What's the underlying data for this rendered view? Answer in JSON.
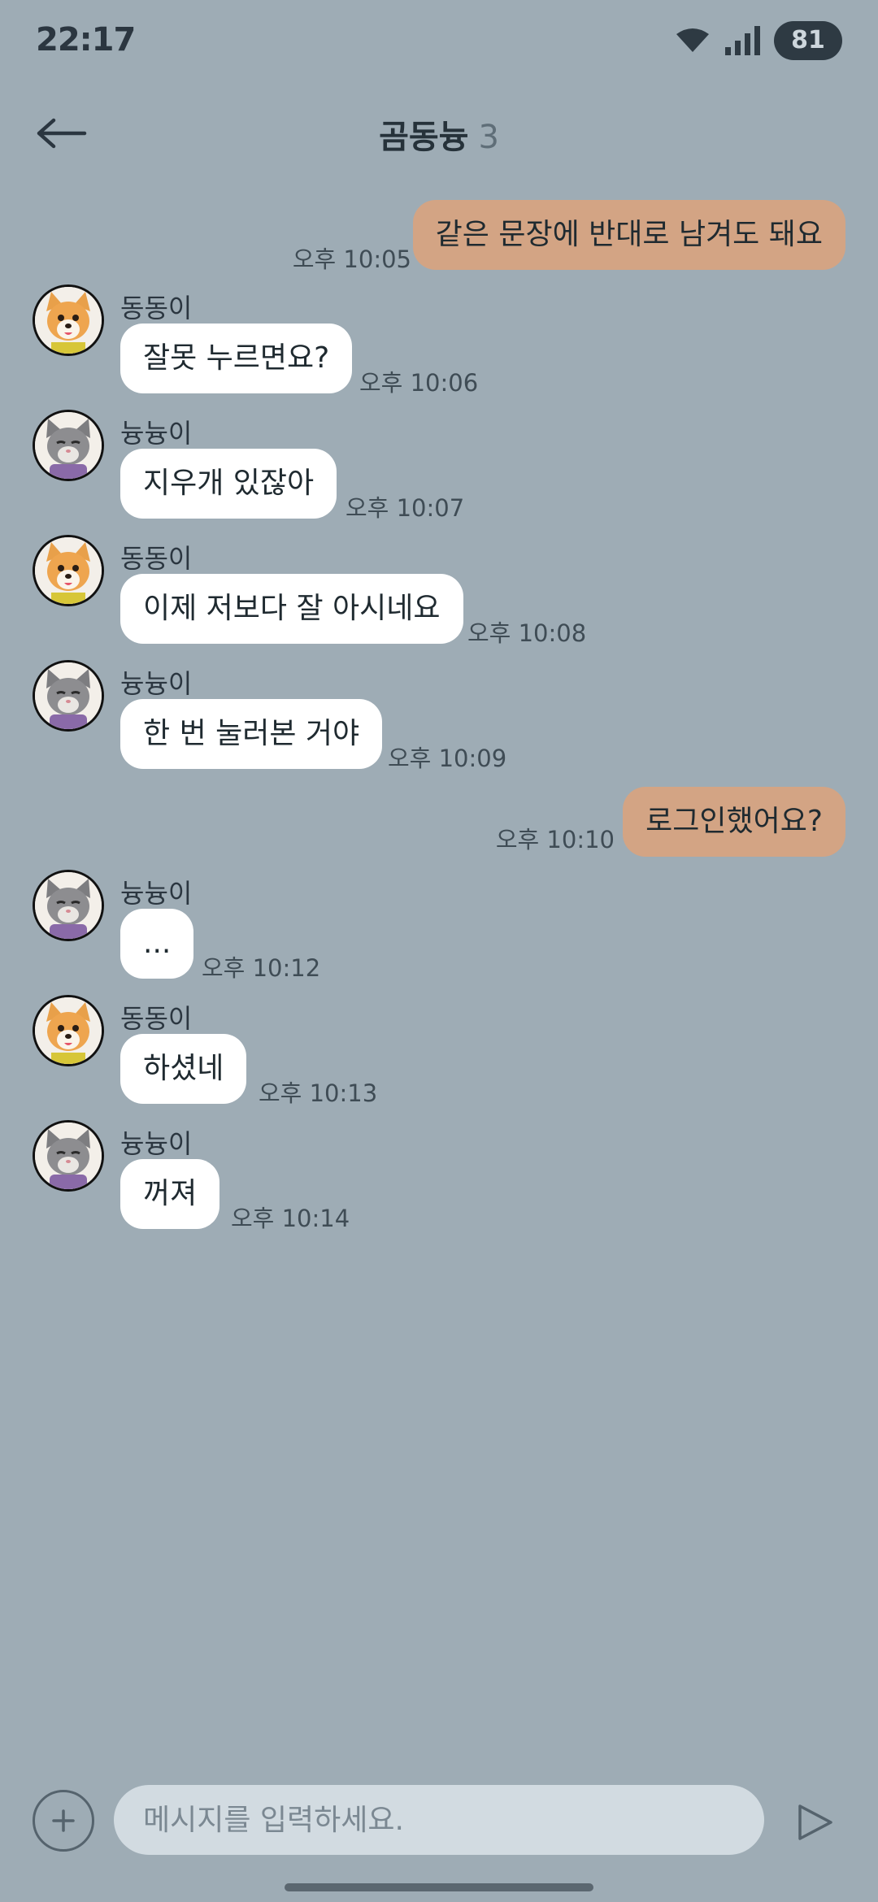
{
  "status_bar": {
    "time": "22:17",
    "battery": "81"
  },
  "header": {
    "title": "곰동늉",
    "member_count": "3"
  },
  "messages": [
    {
      "direction": "out",
      "text": "같은 문장에 반대로 남겨도 돼요",
      "time": "오후 10:05"
    },
    {
      "direction": "in",
      "sender": "동동이",
      "avatar": "dog-avatar",
      "text": "잘못 누르면요?",
      "time": "오후 10:06"
    },
    {
      "direction": "in",
      "sender": "늉늉이",
      "avatar": "cat-avatar",
      "text": "지우개 있잖아",
      "time": "오후 10:07"
    },
    {
      "direction": "in",
      "sender": "동동이",
      "avatar": "dog-avatar",
      "text": "이제 저보다 잘 아시네요",
      "time": "오후 10:08"
    },
    {
      "direction": "in",
      "sender": "늉늉이",
      "avatar": "cat-avatar",
      "text": "한 번 눌러본 거야",
      "time": "오후 10:09"
    },
    {
      "direction": "out",
      "text": "로그인했어요?",
      "time": "오후 10:10"
    },
    {
      "direction": "in",
      "sender": "늉늉이",
      "avatar": "cat-avatar",
      "text": "...",
      "time": "오후 10:12"
    },
    {
      "direction": "in",
      "sender": "동동이",
      "avatar": "dog-avatar",
      "text": "하셨네",
      "time": "오후 10:13"
    },
    {
      "direction": "in",
      "sender": "늉늉이",
      "avatar": "cat-avatar",
      "text": "꺼져",
      "time": "오후 10:14"
    }
  ],
  "composer": {
    "placeholder": "메시지를 입력하세요.",
    "value": ""
  },
  "colors": {
    "background": "#9eacb5",
    "outgoing_bubble": "#d3a484",
    "incoming_bubble": "#ffffff",
    "input_bg": "#d2dbe1"
  }
}
